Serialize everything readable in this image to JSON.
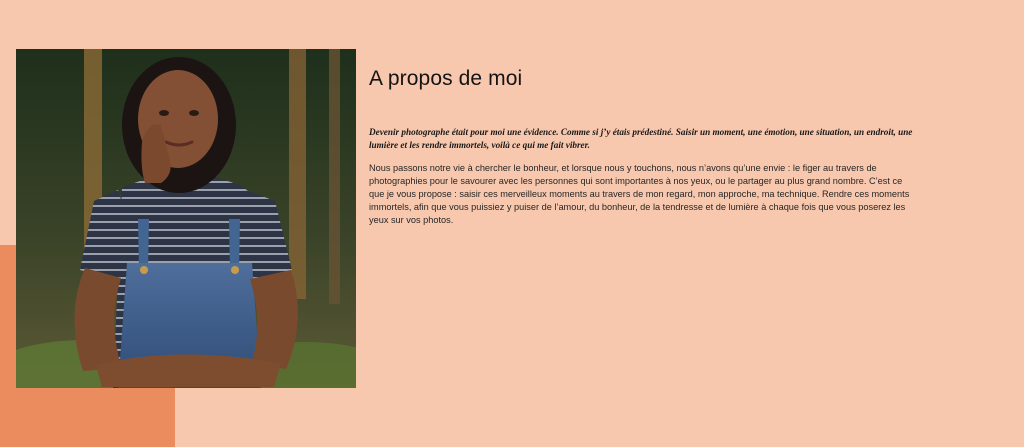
{
  "about": {
    "title": "A propos de moi",
    "lead": "Devenir photographe était pour moi une évidence. Comme si j’y étais prédestiné. Saisir un moment, une émotion, une situation, un endroit, une lumière et les rendre immortels, voilà ce qui me fait vibrer.",
    "body": "Nous passons notre vie à chercher le bonheur, et lorsque nous y touchons, nous n’avons qu’une envie : le figer au travers de photographies pour le savourer avec les personnes qui sont importantes à nos yeux, ou le partager au plus grand nombre. C’est ce que je vous propose : saisir ces merveilleux moments au travers de mon regard, mon approche, ma technique. Rendre ces moments immortels, afin que vous puissiez y puiser de l’amour, du bonheur, de la tendresse et de lumière à chaque fois que vous poserez les yeux sur vos photos."
  },
  "colors": {
    "background": "#f8c8ae",
    "accent": "#ea8c5e"
  }
}
